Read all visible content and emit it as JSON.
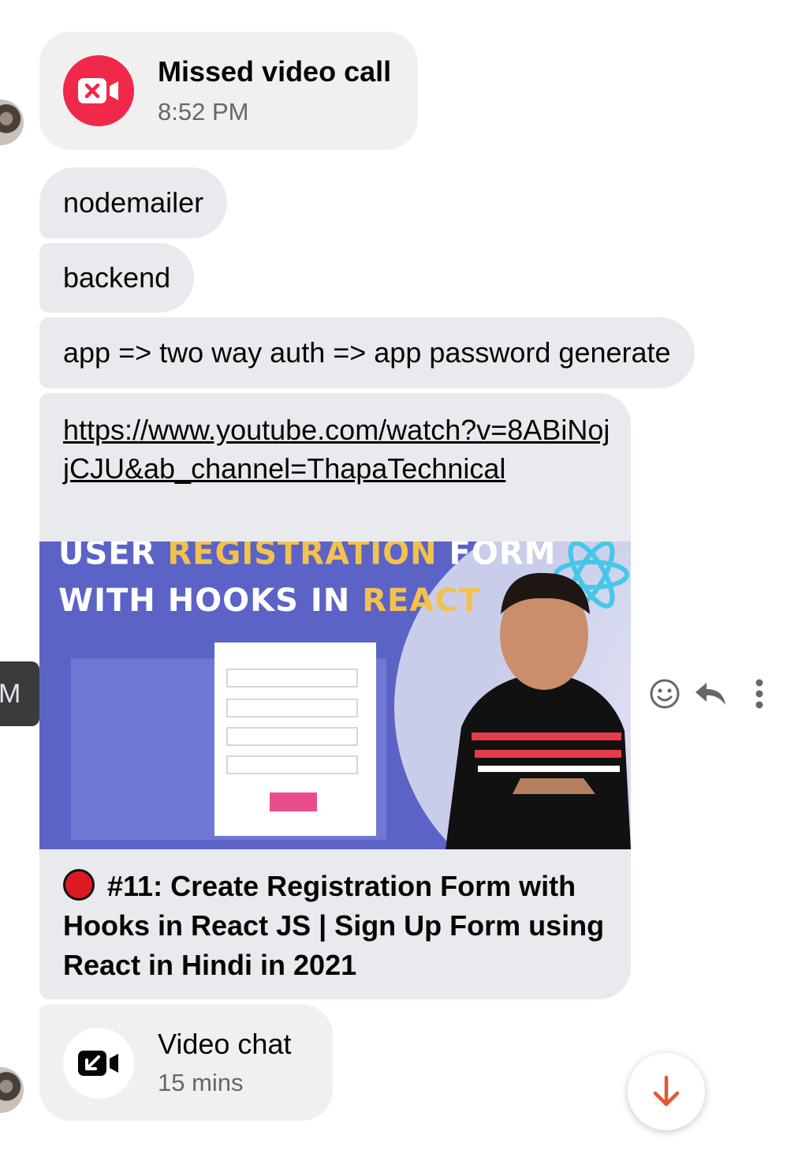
{
  "missed_call": {
    "title": "Missed video call",
    "time": "8:52 PM"
  },
  "messages": [
    {
      "text": "nodemailer"
    },
    {
      "text": "backend"
    },
    {
      "text": "app => two way auth => app password generate"
    }
  ],
  "link_message": {
    "url": "https://www.youtube.com/watch?v=8ABiNojjCJU&ab_channel=ThapaTechnical",
    "thumbnail": {
      "line1_white": "USER",
      "line1_yellow": "REGISTRATION",
      "line1_white2": "FORM",
      "line2_white": "WITH HOOKS IN",
      "line2_yellow": "REACT"
    },
    "preview_title": "#11: Create Registration Form with Hooks in React JS | Sign Up Form using React in Hindi in 2021"
  },
  "video_chat": {
    "title": "Video chat",
    "duration": "15 mins"
  },
  "tooltip": {
    "text": "M"
  },
  "hover_actions": [
    "smiley-icon",
    "reply-icon",
    "more-icon"
  ],
  "colors": {
    "missed_call_red": "#f02849",
    "link_underline": "#050505",
    "scroll_arrow": "#e4572e"
  }
}
